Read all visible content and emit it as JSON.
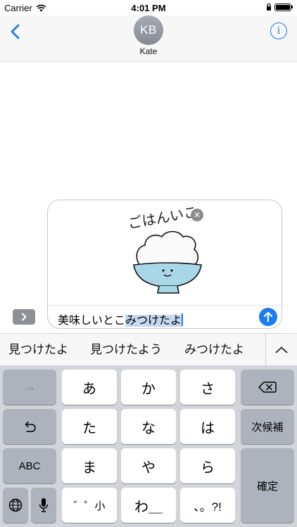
{
  "status": {
    "carrier": "Carrier",
    "time": "4:01 PM",
    "battery_level": 1.0
  },
  "header": {
    "avatar_initials": "KB",
    "contact_name": "Kate",
    "back_icon": "chevron-left-icon",
    "info_icon": "info-icon",
    "info_glyph": "i"
  },
  "compose": {
    "sticker_name": "rice-bowl-sticker",
    "sticker_text": "ごはんいこ",
    "text_committed": "美味しいとこ",
    "text_marked": "みつけたよ",
    "send_icon": "arrow-up-icon",
    "expand_icon": "chevron-right-icon",
    "remove_icon": "close-icon"
  },
  "candidates": {
    "items": [
      "見つけたよ",
      "見つけたよう",
      "みつけたよ"
    ],
    "expand_icon": "chevron-up-icon"
  },
  "keyboard": {
    "row1": [
      "→",
      "あ",
      "か",
      "さ",
      "⌫"
    ],
    "row2": [
      "↺",
      "た",
      "な",
      "は",
      "次候補"
    ],
    "row3": [
      "ABC",
      "ま",
      "や",
      "ら",
      "確定"
    ],
    "row4": [
      "🌐",
      "🎤",
      "゛゜小",
      "わ＿",
      "、。?!"
    ]
  },
  "colors": {
    "accent": "#1b7cf4",
    "keyboard_bg": "#d1d4d9",
    "key_light": "#ffffff",
    "key_dark": "#adb3bc",
    "marked_text_highlight": "#c5d8f4"
  }
}
